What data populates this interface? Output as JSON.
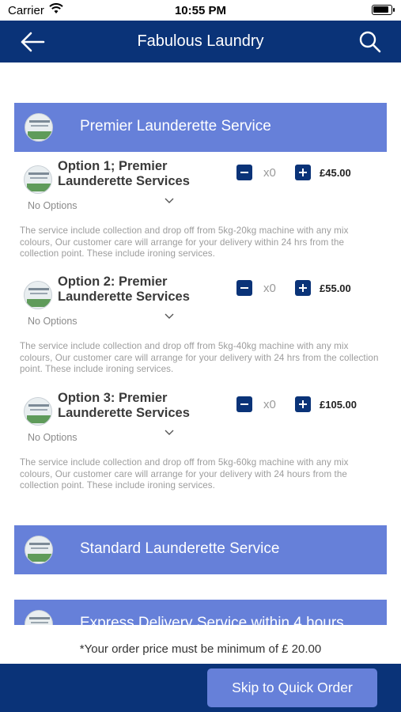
{
  "status_bar": {
    "carrier": "Carrier",
    "time": "10:55 PM",
    "battery_level": 0.9
  },
  "navbar": {
    "title": "Fabulous Laundry",
    "back_icon": "arrow-left-icon",
    "search_icon": "search-icon"
  },
  "categories": [
    {
      "title": "Premier Launderette Service",
      "items": [
        {
          "name": "Option 1; Premier Launderette Services",
          "quantity": "x0",
          "price": "£45.00",
          "options_label": "No Options",
          "description": "The service include collection and drop off from 5kg-20kg machine with any mix colours, Our customer care will arrange for your delivery within 24 hrs from the collection point. These include ironing services."
        },
        {
          "name": "Option 2: Premier Launderette Services",
          "quantity": "x0",
          "price": "£55.00",
          "options_label": "No Options",
          "description": "The service include collection and drop off from 5kg-40kg machine with any mix colours, Our customer care will arrange for your delivery with 24 hrs from the collection point. These include ironing services."
        },
        {
          "name": "Option 3: Premier Launderette Services",
          "quantity": "x0",
          "price": "£105.00",
          "options_label": "No Options",
          "description": "The service include collection and drop off from 5kg-60kg machine with any mix colours, Our customer care will arrange for your delivery with 24 hours from the collection point. These include ironing services."
        }
      ]
    },
    {
      "title": "Standard Launderette Service"
    },
    {
      "title": "Express Delivery Service within 4 hours"
    }
  ],
  "footer": {
    "minimum_order_text": "*Your order price must be minimum of £  20.00",
    "skip_button_label": "Skip to Quick Order"
  },
  "colors": {
    "nav_background": "#0a3378",
    "category_header": "#6680d9",
    "button_background": "#0a3378"
  }
}
